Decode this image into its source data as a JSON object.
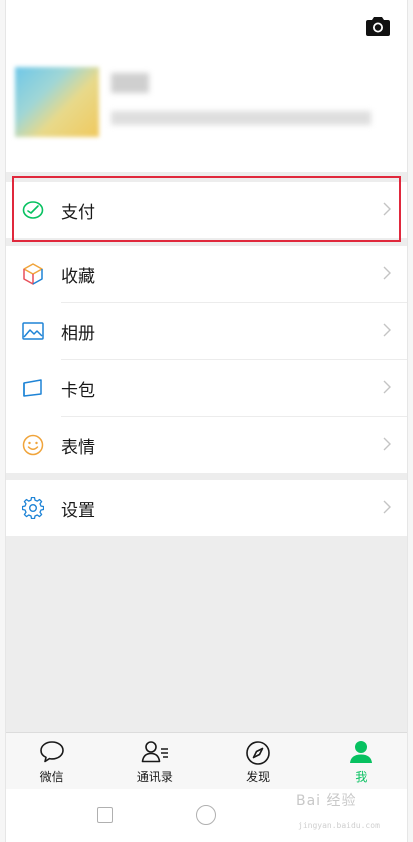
{
  "menu": {
    "pay": "支付",
    "favorites": "收藏",
    "album": "相册",
    "cards": "卡包",
    "stickers": "表情",
    "settings": "设置"
  },
  "tabs": [
    {
      "label": "微信",
      "icon": "chat-bubble-icon"
    },
    {
      "label": "通讯录",
      "icon": "contacts-icon"
    },
    {
      "label": "发现",
      "icon": "compass-icon"
    },
    {
      "label": "我",
      "icon": "person-icon",
      "active": true
    }
  ],
  "colors": {
    "accent": "#07c160",
    "highlight_border": "#e0283c",
    "icon_blue": "#1f84d6",
    "icon_orange": "#f0a43b"
  },
  "watermark": {
    "brand": "Bai 经验",
    "sub": "jingyan.baidu.com"
  }
}
